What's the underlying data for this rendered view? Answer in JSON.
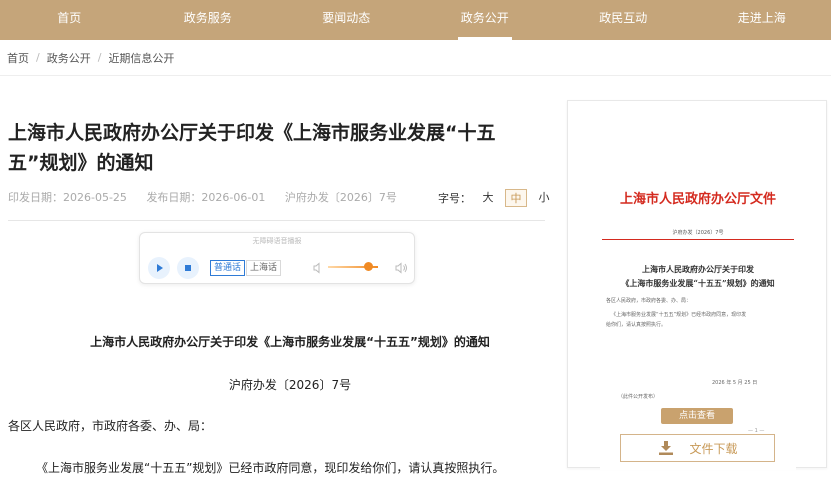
{
  "nav": {
    "items": [
      "首页",
      "政务服务",
      "要闻动态",
      "政务公开",
      "政民互动",
      "走进上海"
    ],
    "active": "政务公开"
  },
  "breadcrumb": [
    "首页",
    "政务公开",
    "近期信息公开"
  ],
  "article": {
    "title_line1": "上海市人民政府办公厅关于印发《上海市服务业发展“十五",
    "title_line2": "五”规划》的通知",
    "print_date": "印发日期：2026-05-25",
    "publish_date": "发布日期：2026-06-01",
    "doc_no_meta": "沪府办发〔2026〕7号",
    "font_size_label": "字号：",
    "font_sizes": [
      "大",
      "中",
      "小"
    ],
    "font_size_selected": "中"
  },
  "player": {
    "label": "无障碍语音播报",
    "lang_mandarin": "普通话",
    "lang_shanghainese": "上海话",
    "volume_level": 0.8
  },
  "body": {
    "heading": "上海市人民政府办公厅关于印发《上海市服务业发展“十五五”规划》的通知",
    "doc_number": "沪府办发〔2026〕7号",
    "salutation": "各区人民政府，市政府各委、办、局：",
    "paragraph": "《上海市服务业发展“十五五”规划》已经市政府同意，现印发给你们，请认真按照执行。"
  },
  "preview": {
    "header": "上海市人民政府办公厅文件",
    "doc_no": "沪府办发〔2026〕7号",
    "title1": "上海市人民政府办公厅关于印发",
    "title2": "《上海市服务业发展“十五五”规划》的通知",
    "line1": "各区人民政府，市政府各委、办、局：",
    "line2": "《上海市服务业发展“十五五”规划》已经市政府同意，现印发",
    "line3": "给你们，请认真按照执行。",
    "date": "2026 年 5 月 25 日",
    "public_note": "（此件公开发布）",
    "page_mark": "— 1 —",
    "view_button": "点击查看",
    "download_button": "文件下载"
  },
  "colors": {
    "nav_bg": "#c5a57a",
    "accent_gold": "#c89a58",
    "doc_red": "#d42a1f",
    "player_blue": "#2f7bd6",
    "volume_orange": "#f08a24"
  }
}
